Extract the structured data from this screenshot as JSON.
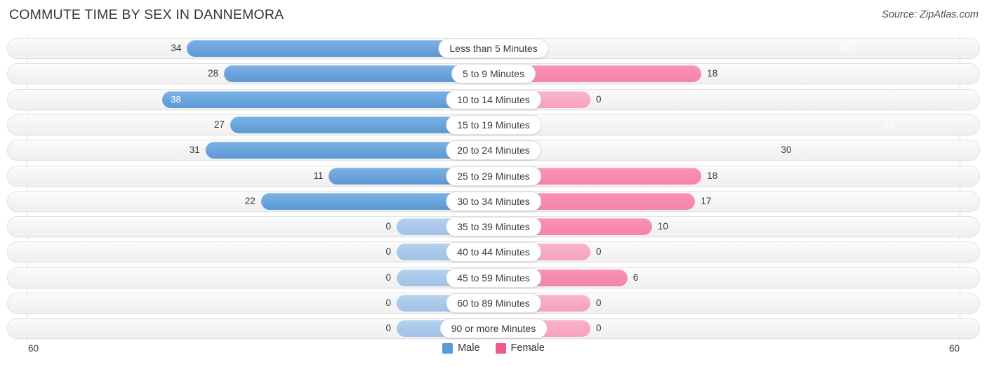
{
  "header": {
    "title": "COMMUTE TIME BY SEX IN DANNEMORA",
    "source": "Source: ZipAtlas.com"
  },
  "axis": {
    "left_max": "60",
    "right_max": "60"
  },
  "legend": {
    "items": [
      {
        "label": "Male",
        "color": "#5b9bd5"
      },
      {
        "label": "Female",
        "color": "#f2588c"
      }
    ]
  },
  "chart_data": {
    "type": "bar",
    "title": "COMMUTE TIME BY SEX IN DANNEMORA",
    "subtitle": "Source: ZipAtlas.com",
    "orientation": "horizontal-diverging",
    "xlabel": "",
    "ylabel": "",
    "xlim": [
      -60,
      60
    ],
    "axis_max": 60,
    "grid": true,
    "legend_position": "bottom-center",
    "categories": [
      "Less than 5 Minutes",
      "5 to 9 Minutes",
      "10 to 14 Minutes",
      "15 to 19 Minutes",
      "20 to 24 Minutes",
      "25 to 29 Minutes",
      "30 to 34 Minutes",
      "35 to 39 Minutes",
      "40 to 44 Minutes",
      "45 to 59 Minutes",
      "60 to 89 Minutes",
      "90 or more Minutes"
    ],
    "series": [
      {
        "name": "Male",
        "color": "#5b9bd5",
        "values": [
          34,
          28,
          38,
          27,
          31,
          11,
          22,
          0,
          0,
          0,
          0,
          0
        ]
      },
      {
        "name": "Female",
        "color": "#f2588c",
        "values": [
          44,
          18,
          0,
          51,
          30,
          18,
          17,
          10,
          0,
          6,
          0,
          0
        ]
      }
    ]
  },
  "rows": [
    {
      "label": "Less than 5 Minutes",
      "male": "34",
      "female": "44",
      "male_inside": false,
      "female_inside": true,
      "male_tone": "normal",
      "female_tone": "strong"
    },
    {
      "label": "5 to 9 Minutes",
      "male": "28",
      "female": "18",
      "male_inside": false,
      "female_inside": false,
      "male_tone": "normal",
      "female_tone": "mid"
    },
    {
      "label": "10 to 14 Minutes",
      "male": "38",
      "female": "0",
      "male_inside": true,
      "female_inside": false,
      "male_tone": "normal",
      "female_tone": "pale"
    },
    {
      "label": "15 to 19 Minutes",
      "male": "27",
      "female": "51",
      "male_inside": false,
      "female_inside": true,
      "male_tone": "normal",
      "female_tone": "strong"
    },
    {
      "label": "20 to 24 Minutes",
      "male": "31",
      "female": "30",
      "male_inside": false,
      "female_inside": false,
      "male_tone": "normal",
      "female_tone": "strong"
    },
    {
      "label": "25 to 29 Minutes",
      "male": "11",
      "female": "18",
      "male_inside": false,
      "female_inside": false,
      "male_tone": "normal",
      "female_tone": "mid"
    },
    {
      "label": "30 to 34 Minutes",
      "male": "22",
      "female": "17",
      "male_inside": false,
      "female_inside": false,
      "male_tone": "normal",
      "female_tone": "mid"
    },
    {
      "label": "35 to 39 Minutes",
      "male": "0",
      "female": "10",
      "male_inside": false,
      "female_inside": false,
      "male_tone": "pale",
      "female_tone": "mid"
    },
    {
      "label": "40 to 44 Minutes",
      "male": "0",
      "female": "0",
      "male_inside": false,
      "female_inside": false,
      "male_tone": "pale",
      "female_tone": "pale"
    },
    {
      "label": "45 to 59 Minutes",
      "male": "0",
      "female": "6",
      "male_inside": false,
      "female_inside": false,
      "male_tone": "pale",
      "female_tone": "mid"
    },
    {
      "label": "60 to 89 Minutes",
      "male": "0",
      "female": "0",
      "male_inside": false,
      "female_inside": false,
      "male_tone": "pale",
      "female_tone": "pale"
    },
    {
      "label": "90 or more Minutes",
      "male": "0",
      "female": "0",
      "male_inside": false,
      "female_inside": false,
      "male_tone": "pale",
      "female_tone": "pale"
    }
  ]
}
